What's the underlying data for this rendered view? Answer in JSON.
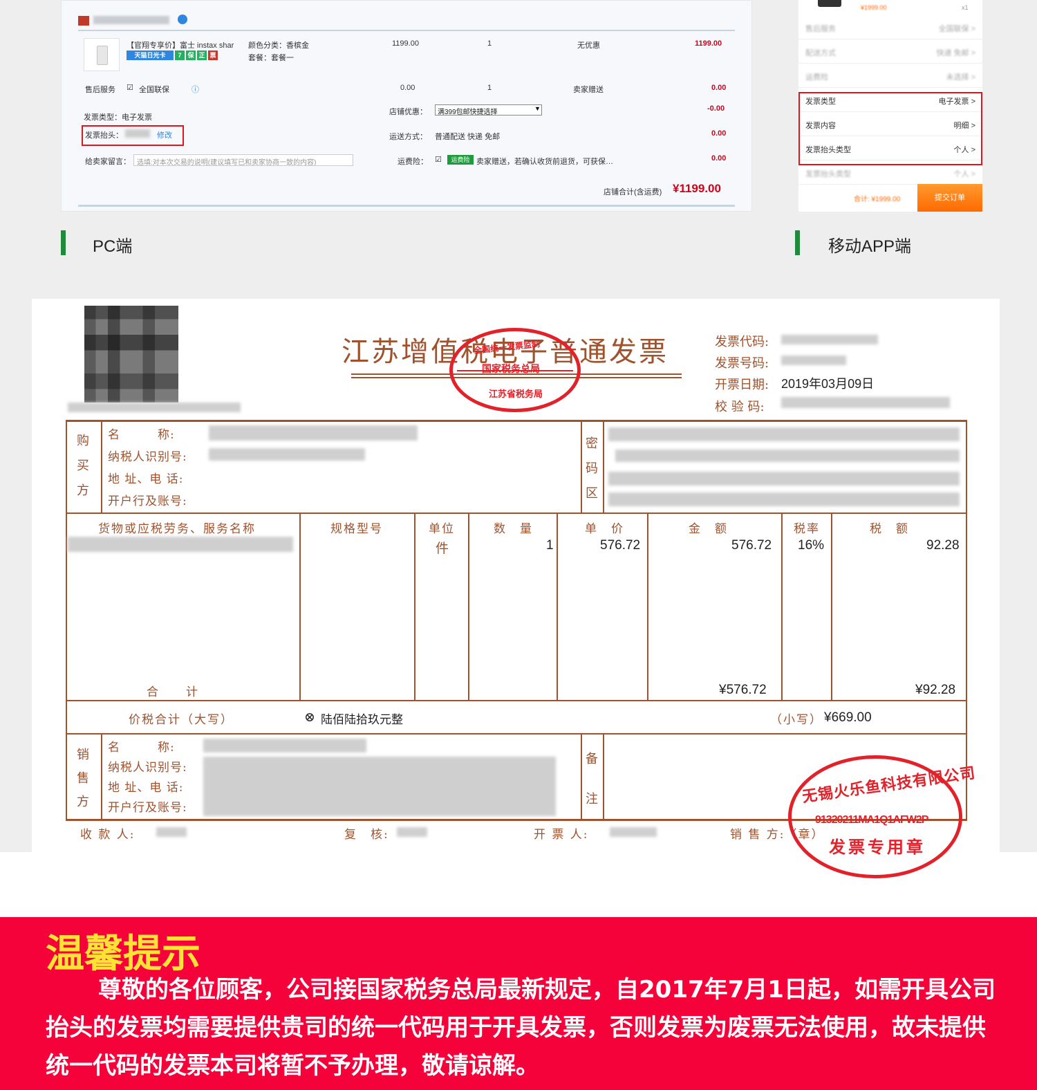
{
  "pc": {
    "product_title": "【官翔专享价】富士 instax shar",
    "color_label": "颜色分类：香槟金",
    "set_label": "套餐：套餐一",
    "price": "1199.00",
    "qty": "1",
    "discount": "无优惠",
    "subtotal": "1199.00",
    "service_label": "售后服务",
    "service_value": "全国联保",
    "service_price": "0.00",
    "service_qty": "1",
    "service_ship": "卖家赠送",
    "service_total": "0.00",
    "invoice_type": "发票类型：电子发票",
    "invoice_head": "发票抬头：",
    "invoice_edit": "修改",
    "shop_discount_label": "店铺优惠：",
    "shop_discount_value": "满399包邮快捷选择",
    "shop_discount_amount": "-0.00",
    "ship_label": "运送方式：",
    "ship_value": "普通配送 快递 免邮",
    "ship_amount": "0.00",
    "msg_label": "给卖家留言：",
    "msg_placeholder": "选填:对本次交易的说明(建议填写已和卖家协商一致的内容)",
    "insurance_label": "运费险：",
    "insurance_tag": "运费险",
    "insurance_value": "卖家赠送，若确认收货前退货，可获保…",
    "insurance_amount": "0.00",
    "total_label": "店铺合计(含运费)",
    "total_value": "¥1199.00",
    "tags": [
      {
        "t": "天猫日光卡",
        "c": "#2e86de",
        "w": 68
      },
      {
        "t": "7",
        "c": "#27ae60",
        "w": 14
      },
      {
        "t": "保",
        "c": "#27ae60",
        "w": 14
      },
      {
        "t": "正",
        "c": "#27ae60",
        "w": 14
      },
      {
        "t": "票",
        "c": "#c0392b",
        "w": 14
      }
    ],
    "label": "PC端"
  },
  "mobile": {
    "top_price": "¥1999.00",
    "top_qty": "x1",
    "rows": [
      {
        "l": "售后服务",
        "r": "全国联保 >",
        "faded": true
      },
      {
        "l": "配送方式",
        "r": "快递 免邮 >",
        "faded": true
      },
      {
        "l": "运费险",
        "r": "未选择 >",
        "faded": true
      },
      {
        "l": "发票类型",
        "r": "电子发票 >",
        "faded": false
      },
      {
        "l": "发票内容",
        "r": "明细 >",
        "faded": false
      },
      {
        "l": "发票抬头类型",
        "r": "个人 >",
        "faded": false
      },
      {
        "l": "发票抬头类型",
        "r": "个人 >",
        "faded": true
      }
    ],
    "total": "合计: ¥1999.00",
    "submit": "提交订单",
    "label": "移动APP端"
  },
  "invoice": {
    "title": "江苏增值税电子普通发票",
    "meta": {
      "code_label": "发票代码:",
      "number_label": "发票号码:",
      "date_label": "开票日期:",
      "date_value": "2019年03月09日",
      "check_label": "校 验 码:"
    },
    "buyer_side": "购买方",
    "buyer_fields": [
      "名　　　称:",
      "纳税人识别号:",
      "地 址、电 话:",
      "开户行及账号:"
    ],
    "cipher_side": "密码区",
    "columns": {
      "name": "货物或应税劳务、服务名称",
      "spec": "规格型号",
      "unit": "单位",
      "qty": "数　量",
      "price": "单　价",
      "amount": "金　额",
      "rate": "税率",
      "tax": "税　额"
    },
    "item": {
      "unit": "件",
      "qty": "1",
      "price": "576.72",
      "amount": "576.72",
      "rate": "16%",
      "tax": "92.28"
    },
    "sum_label": "合　　计",
    "sum_amount": "¥576.72",
    "sum_tax": "¥92.28",
    "total_upper_label": "价税合计（大写）",
    "total_upper_value": "陆佰陆拾玖元整",
    "total_lower_label": "（小写）",
    "total_lower_value": "¥669.00",
    "seller_side": "销售方",
    "seller_fields": [
      "名　　　称:",
      "纳税人识别号:",
      "地 址、电 话:",
      "开户行及账号:"
    ],
    "remark_side": "备注",
    "footer": {
      "payee": "收 款 人:",
      "reviewer": "复　核:",
      "issuer": "开 票 人:",
      "seller": "销 售 方:（章）"
    },
    "stamp_tax": {
      "top": "全国统一发票监制",
      "mid": "国家税务总局",
      "bottom": "江苏省税务局"
    },
    "stamp_company": {
      "name": "无锡火乐鱼科技有限公司",
      "code": "91320211MA1Q1AFW2P",
      "bottom": "发票专用章"
    }
  },
  "notice": {
    "title": "温馨提示",
    "text": "尊敬的各位顾客，公司接国家税务总局最新规定，自2017年7月1日起，如需开具公司抬头的发票均需要提供贵司的统一代码用于开具发票，否则发票为废票无法使用，故未提供统一代码的发票本司将暂不予办理，敬请谅解。"
  },
  "colors": {
    "notice_bg": "#f5023a",
    "notice_title": "#ffe236",
    "invoice_brown": "#a0522d",
    "stamp_red": "#e2222a",
    "highlight_red": "#e0141e",
    "label_green": "#1e8a3a"
  }
}
